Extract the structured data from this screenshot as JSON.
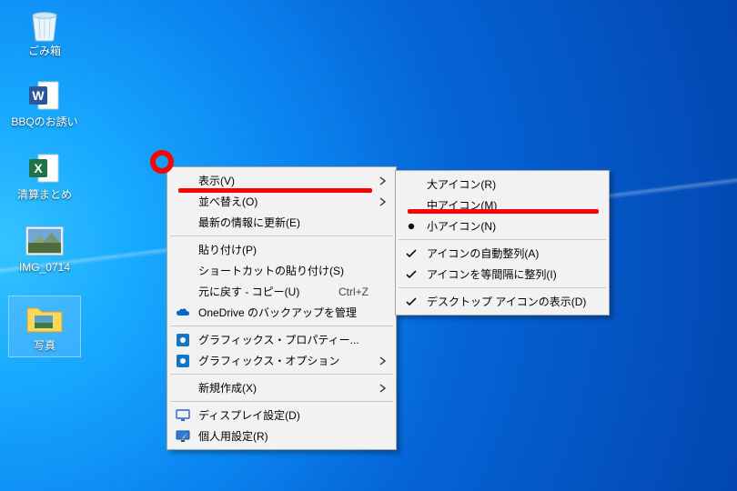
{
  "desktop_icons": [
    {
      "id": "recycle-bin",
      "label": "ごみ箱"
    },
    {
      "id": "word-doc",
      "label": "BBQのお誘い"
    },
    {
      "id": "excel-doc",
      "label": "清算まとめ"
    },
    {
      "id": "photo-file",
      "label": "IMG_0714"
    },
    {
      "id": "photo-folder",
      "label": "写真"
    }
  ],
  "context_menu": {
    "items": {
      "view": {
        "label": "表示(V)"
      },
      "sort": {
        "label": "並べ替え(O)"
      },
      "refresh": {
        "label": "最新の情報に更新(E)"
      },
      "paste": {
        "label": "貼り付け(P)"
      },
      "paste_sc": {
        "label": "ショートカットの貼り付け(S)"
      },
      "undo": {
        "label": "元に戻す - コピー(U)",
        "shortcut": "Ctrl+Z"
      },
      "onedrive": {
        "label": "OneDrive のバックアップを管理"
      },
      "gfx_prop": {
        "label": "グラフィックス・プロパティー..."
      },
      "gfx_opt": {
        "label": "グラフィックス・オプション"
      },
      "new": {
        "label": "新規作成(X)"
      },
      "display": {
        "label": "ディスプレイ設定(D)"
      },
      "personalize": {
        "label": "個人用設定(R)"
      }
    }
  },
  "view_submenu": {
    "items": {
      "large": {
        "label": "大アイコン(R)"
      },
      "medium": {
        "label": "中アイコン(M)"
      },
      "small": {
        "label": "小アイコン(N)"
      },
      "auto": {
        "label": "アイコンの自動整列(A)"
      },
      "align": {
        "label": "アイコンを等間隔に整列(I)"
      },
      "show": {
        "label": "デスクトップ アイコンの表示(D)"
      }
    },
    "current_size": "small",
    "auto_arrange": true,
    "align_grid": true,
    "show_icons": true
  },
  "annotations": {
    "circle_hint": "context-menu-origin",
    "underline1": "表示(V) highlighted",
    "underline2": "中アイコン(M) highlighted"
  }
}
